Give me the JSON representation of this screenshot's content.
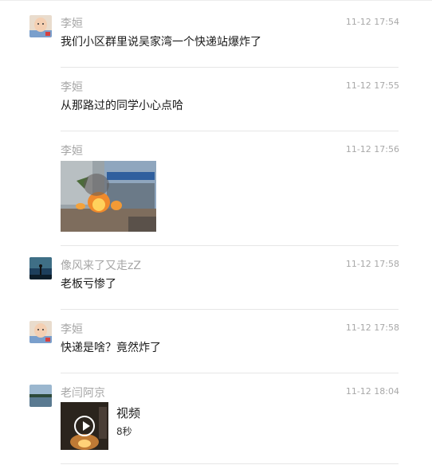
{
  "messages": [
    {
      "sender": "李姮",
      "time": "11-12 17:54",
      "text": "我们小区群里说吴家湾一个快递站爆炸了",
      "avatar": "baby-avatar"
    },
    {
      "sender": "李姮",
      "time": "11-12 17:55",
      "text": "从那路过的同学小心点哈"
    },
    {
      "sender": "李姮",
      "time": "11-12 17:56",
      "image": "fire-photo"
    },
    {
      "sender": "像风来了又走zZ",
      "time": "11-12 17:58",
      "text": "老板亏惨了",
      "avatar": "silhouette-avatar"
    },
    {
      "sender": "李姮",
      "time": "11-12 17:58",
      "text": "快递是啥？竟然炸了",
      "avatar": "baby-avatar"
    },
    {
      "sender": "老闫阿京",
      "time": "11-12 18:04",
      "video": {
        "title": "视频",
        "duration": "8秒"
      },
      "avatar": "lake-avatar"
    }
  ]
}
